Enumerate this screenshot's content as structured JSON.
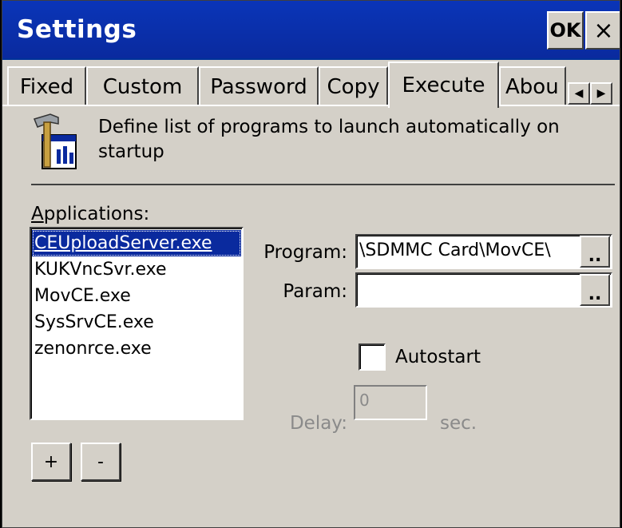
{
  "window": {
    "title": "Settings",
    "ok_label": "OK",
    "close_label": "×"
  },
  "tabs": [
    {
      "label": "Fixed",
      "active": false
    },
    {
      "label": "Custom",
      "active": false
    },
    {
      "label": "Password",
      "active": false
    },
    {
      "label": "Copy",
      "active": false
    },
    {
      "label": "Execute",
      "active": true
    },
    {
      "label": "Abou",
      "active": false
    }
  ],
  "tab_scroll": {
    "left": "◀",
    "right": "▶"
  },
  "header": {
    "icon": "hammer-settings-icon",
    "description": "Define list of programs to launch automatically on startup"
  },
  "applications": {
    "label_accel": "A",
    "label_rest": "pplications:",
    "items": [
      "CEUploadServer.exe",
      "KUKVncSvr.exe",
      "MovCE.exe",
      "SysSrvCE.exe",
      "zenonrce.exe"
    ],
    "selected_index": 0
  },
  "form": {
    "program_label": "Program:",
    "program_value": "\\SDMMC Card\\MovCE\\",
    "param_label": "Param:",
    "param_value": "",
    "browse_label": "..",
    "autostart_label": "Autostart",
    "autostart_checked": false,
    "delay_label": "Delay:",
    "delay_value": "0",
    "delay_unit": "sec."
  },
  "buttons": {
    "add": "+",
    "remove": "-"
  }
}
